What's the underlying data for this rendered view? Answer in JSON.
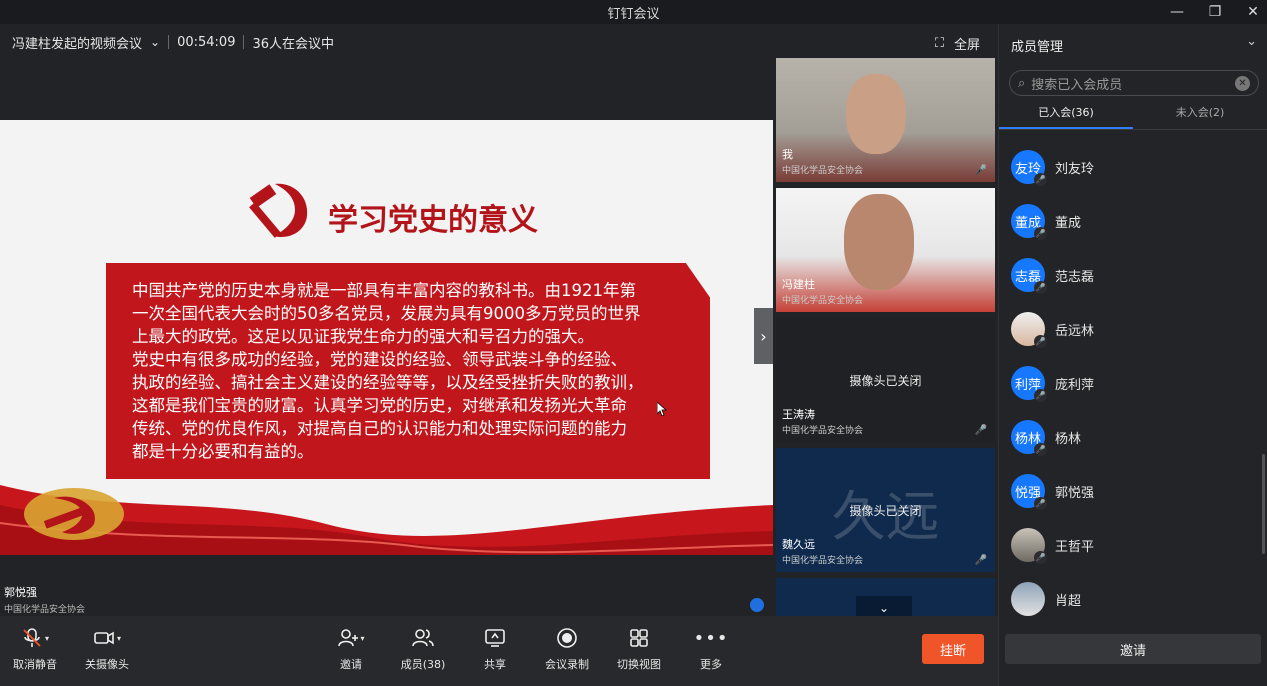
{
  "window": {
    "title": "钉钉会议"
  },
  "meeting": {
    "name": "冯建柱发起的视频会议",
    "elapsed": "00:54:09",
    "participants_text": "36人在会议中",
    "fullscreen_label": "全屏"
  },
  "slide": {
    "title": "学习党史的意义",
    "body": [
      "中国共产党的历史本身就是一部具有丰富内容的教科书。由1921年第",
      "一次全国代表大会时的50多名党员，发展为具有9000多万党员的世界",
      "上最大的政党。这足以见证我党生命力的强大和号召力的强大。",
      "党史中有很多成功的经验，党的建设的经验、领导武装斗争的经验、",
      "执政的经验、搞社会主义建设的经验等等，以及经受挫折失败的教训，",
      "这都是我们宝贵的财富。认真学习党的历史，对继承和发扬光大革命",
      "传统、党的优良作风，对提高自己的认识能力和处理实际问题的能力",
      "都是十分必要和有益的。"
    ]
  },
  "speaker": {
    "name": "郭悦强",
    "org": "中国化学品安全协会"
  },
  "tiles": [
    {
      "name": "我",
      "org": "中国化学品安全协会",
      "status": ""
    },
    {
      "name": "冯建柱",
      "org": "中国化学品安全协会",
      "status": ""
    },
    {
      "name": "王涛涛",
      "org": "中国化学品安全协会",
      "status": "摄像头已关闭"
    },
    {
      "name": "魏久远",
      "org": "中国化学品安全协会",
      "status": "摄像头已关闭",
      "big": "久远"
    }
  ],
  "toolbar": {
    "unmute": "取消静音",
    "camera_off": "关摄像头",
    "invite": "邀请",
    "members": "成员(38)",
    "share": "共享",
    "record": "会议录制",
    "switch_view": "切换视图",
    "more": "更多",
    "hangup": "挂断"
  },
  "panel": {
    "title": "成员管理",
    "search_placeholder": "搜索已入会成员",
    "tab_joined": "已入会(36)",
    "tab_not_joined": "未入会(2)",
    "members": [
      {
        "name": "刘友玲",
        "avatar_text": "友玲"
      },
      {
        "name": "董成",
        "avatar_text": "董成"
      },
      {
        "name": "范志磊",
        "avatar_text": "志磊"
      },
      {
        "name": "岳远林",
        "avatar_text": ""
      },
      {
        "name": "庞利萍",
        "avatar_text": "利萍"
      },
      {
        "name": "杨林",
        "avatar_text": "杨林"
      },
      {
        "name": "郭悦强",
        "avatar_text": "悦强"
      },
      {
        "name": "王哲平",
        "avatar_text": ""
      },
      {
        "name": "肖超",
        "avatar_text": ""
      }
    ],
    "invite_label": "邀请"
  },
  "colors": {
    "accent": "#1677ff",
    "hangup": "#f0552a",
    "slide_red": "#c1161c"
  }
}
